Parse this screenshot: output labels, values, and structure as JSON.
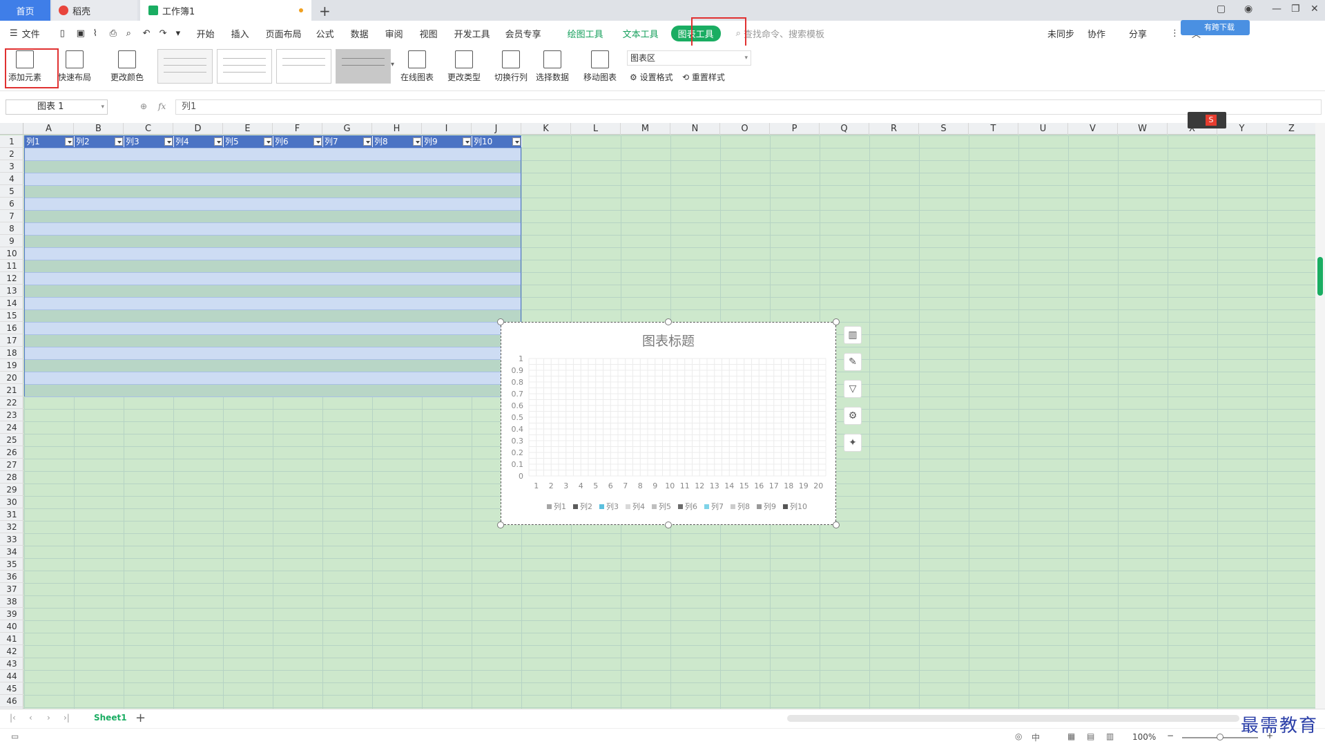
{
  "titlebar": {
    "tabs": [
      {
        "label": "首页"
      },
      {
        "label": "稻壳"
      },
      {
        "label": "工作簿1"
      }
    ],
    "new_tab_label": "+"
  },
  "menubar": {
    "file_label": "文件",
    "items": [
      "开始",
      "插入",
      "页面布局",
      "公式",
      "数据",
      "审阅",
      "视图",
      "开发工具",
      "会员专享"
    ],
    "context_tabs": [
      "绘图工具",
      "文本工具"
    ],
    "active_context_tab": "图表工具",
    "search_placeholder": "查找命令、搜索模板",
    "right_items": [
      "未同步",
      "协作",
      "分享"
    ],
    "cloud_badge": "有跨下载"
  },
  "ribbon": {
    "add_element": "添加元素",
    "quick_layout": "快速布局",
    "change_color": "更改颜色",
    "online_chart": "在线图表",
    "change_type": "更改类型",
    "switch_row_col": "切换行列",
    "select_data": "选择数据",
    "move_chart": "移动图表",
    "chart_area_select": "图表区",
    "set_format": "设置格式",
    "reset_style": "重置样式"
  },
  "formula": {
    "name_box": "图表 1",
    "fx": "fx",
    "content": "列1"
  },
  "sheet": {
    "columns": [
      "A",
      "B",
      "C",
      "D",
      "E",
      "F",
      "G",
      "H",
      "I",
      "J",
      "K",
      "L",
      "M",
      "N",
      "O",
      "P",
      "Q",
      "R",
      "S",
      "T",
      "U",
      "V",
      "W",
      "X",
      "Y",
      "Z"
    ],
    "rows": [
      "1",
      "2",
      "3",
      "4",
      "5",
      "6",
      "7",
      "8",
      "9",
      "10",
      "11",
      "12",
      "13",
      "14",
      "15",
      "16",
      "17",
      "18",
      "19",
      "20",
      "21",
      "22",
      "23",
      "24",
      "25",
      "26",
      "27",
      "28",
      "29",
      "30",
      "31",
      "32",
      "33",
      "34",
      "35",
      "36",
      "37",
      "38",
      "39",
      "40",
      "41",
      "42",
      "43",
      "44",
      "45",
      "46"
    ],
    "table_headers": [
      "列1",
      "列2",
      "列3",
      "列4",
      "列5",
      "列6",
      "列7",
      "列8",
      "列9",
      "列10"
    ]
  },
  "chart_data": {
    "type": "bar",
    "title": "图表标题",
    "categories": [
      "1",
      "2",
      "3",
      "4",
      "5",
      "6",
      "7",
      "8",
      "9",
      "10",
      "11",
      "12",
      "13",
      "14",
      "15",
      "16",
      "17",
      "18",
      "19",
      "20"
    ],
    "y_ticks": [
      "0",
      "0.1",
      "0.2",
      "0.3",
      "0.4",
      "0.5",
      "0.6",
      "0.7",
      "0.8",
      "0.9",
      "1"
    ],
    "ylim": [
      0,
      1
    ],
    "grid": true,
    "legend_placement": "bottom",
    "series": [
      {
        "name": "列1",
        "color": "#a5a5a5",
        "values": []
      },
      {
        "name": "列2",
        "color": "#5b5b5b",
        "values": []
      },
      {
        "name": "列3",
        "color": "#5bc0de",
        "values": []
      },
      {
        "name": "列4",
        "color": "#d9d9d9",
        "values": []
      },
      {
        "name": "列5",
        "color": "#bfbfbf",
        "values": []
      },
      {
        "name": "列6",
        "color": "#6b6b6b",
        "values": []
      },
      {
        "name": "列7",
        "color": "#7fd3e8",
        "values": []
      },
      {
        "name": "列8",
        "color": "#cccccc",
        "values": []
      },
      {
        "name": "列9",
        "color": "#999999",
        "values": []
      },
      {
        "name": "列10",
        "color": "#555555",
        "values": []
      }
    ]
  },
  "sheettabs": {
    "active": "Sheet1",
    "add_label": "+"
  },
  "status": {
    "zoom": "100%"
  },
  "watermark": "最需教育"
}
